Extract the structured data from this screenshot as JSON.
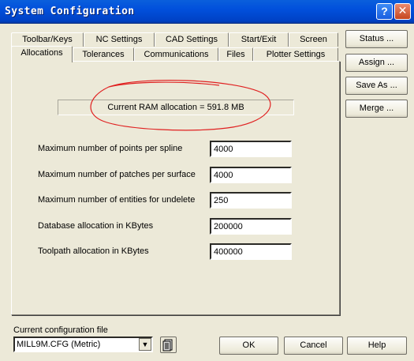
{
  "window": {
    "title": "System Configuration",
    "help_glyph": "?",
    "close_glyph": "✕"
  },
  "tabs": {
    "row1": [
      "Toolbar/Keys",
      "NC Settings",
      "CAD Settings",
      "Start/Exit",
      "Screen"
    ],
    "row2": [
      "Allocations",
      "Tolerances",
      "Communications",
      "Files",
      "Plotter Settings"
    ],
    "active": "Allocations"
  },
  "allocations": {
    "ram_text": "Current RAM allocation = 591.8 MB",
    "fields": [
      {
        "label": "Maximum number of points per spline",
        "value": "4000"
      },
      {
        "label": "Maximum number of patches per surface",
        "value": "4000"
      },
      {
        "label": "Maximum number of entities for undelete",
        "value": "250"
      },
      {
        "label": "Database allocation in KBytes",
        "value": "200000"
      },
      {
        "label": "Toolpath allocation in KBytes",
        "value": "400000"
      }
    ]
  },
  "side_buttons": {
    "status": "Status ...",
    "assign": "Assign ...",
    "save_as": "Save As ...",
    "merge": "Merge ..."
  },
  "bottom": {
    "config_label": "Current configuration file",
    "config_value": "MILL9M.CFG (Metric)",
    "dropdown_glyph": "▼",
    "file_icon": "file-icon",
    "ok": "OK",
    "cancel": "Cancel",
    "help": "Help"
  },
  "colors": {
    "titlebar": "#0150dc",
    "dialog_bg": "#ece9d8",
    "annotation_circle": "#e02020"
  }
}
